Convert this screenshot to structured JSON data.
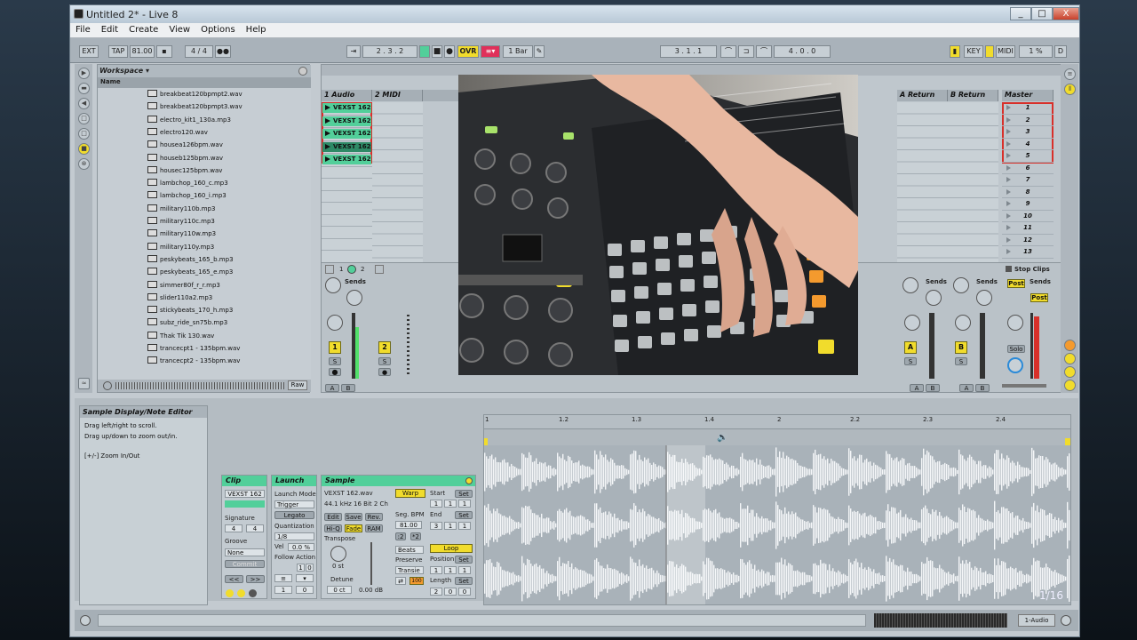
{
  "window": {
    "title": "Untitled 2* - Live 8",
    "min": "_",
    "max": "□",
    "close": "X"
  },
  "menu": [
    "File",
    "Edit",
    "Create",
    "View",
    "Options",
    "Help"
  ],
  "control_bar": {
    "ext": "EXT",
    "tap": "TAP",
    "tempo": "81.00",
    "signature": "4 / 4",
    "metro": "●●",
    "position": "2 .  3 .  2",
    "ovr": "OVR",
    "quantize": "1 Bar",
    "loop_start": "3 .  1 .  1",
    "loop_len": "4 .  0 .  0",
    "key": "KEY",
    "midi": "MIDI",
    "cpu": "1 %",
    "d": "D"
  },
  "browser": {
    "workspace": "Workspace ▾",
    "name_header": "Name",
    "files": [
      "breakbeat120bpmpt2.wav",
      "breakbeat120bpmpt3.wav",
      "electro_kit1_130a.mp3",
      "electro120.wav",
      "housea126bpm.wav",
      "houseb125bpm.wav",
      "housec125bpm.wav",
      "lambchop_160_c.mp3",
      "lambchop_160_i.mp3",
      "military110b.mp3",
      "military110c.mp3",
      "military110w.mp3",
      "military110y.mp3",
      "peskybeats_165_b.mp3",
      "peskybeats_165_e.mp3",
      "simmer80f_r_r.mp3",
      "slider110a2.mp3",
      "stickybeats_170_h.mp3",
      "subz_ride_sn75b.mp3",
      "Thak Tik 130.wav",
      "trancecpt1 - 135bpm.wav",
      "trancecpt2 - 135bpm.wav"
    ],
    "raw": "Raw"
  },
  "session": {
    "tracks": [
      "1 Audio",
      "2 MIDI"
    ],
    "returns": [
      "A Return",
      "B Return"
    ],
    "master": "Master",
    "clips": [
      "VEXST 162",
      "VEXST 162",
      "VEXST 162",
      "VEXST 162",
      "VEXST 162"
    ],
    "scenes": [
      "1",
      "2",
      "3",
      "4",
      "5",
      "6",
      "7",
      "8",
      "9",
      "10",
      "11",
      "12",
      "13"
    ],
    "stop_clips": "Stop Clips",
    "sends": "Sends",
    "post": "Post",
    "solo": "Solo",
    "track1_num": "1",
    "track2_num": "2",
    "return_a": "A",
    "return_b": "B",
    "s": "S",
    "a": "A",
    "b": "B",
    "io_1": "1",
    "io_2": "2"
  },
  "info_view": {
    "title": "Sample Display/Note Editor",
    "line1": "Drag left/right to scroll.",
    "line2": "Drag up/down to zoom out/in.",
    "line3": "[+/-] Zoom In/Out"
  },
  "clip_view": {
    "clip_head": "Clip",
    "clip_name": "VEXST 162",
    "signature_label": "Signature",
    "sig_num": "4",
    "sig_den": "4",
    "groove_label": "Groove",
    "groove_value": "None",
    "commit": "Commit",
    "launch_head": "Launch",
    "launch_mode_label": "Launch Mode",
    "launch_mode": "Trigger",
    "legato": "Legato",
    "quantization_label": "Quantization",
    "quantization": "1/8",
    "vel_label": "Vel",
    "vel": "0.0 %",
    "follow_action": "Follow Action",
    "fa1": "1",
    "fa2": "0",
    "fa3": "0",
    "fa4": "1",
    "fa5": "0",
    "sample_head": "Sample",
    "sample_name": "VEXST 162.wav",
    "sample_info": "44.1 kHz 16 Bit 2 Ch",
    "warp": "Warp",
    "edit": "Edit",
    "save": "Save",
    "rev": "Rev.",
    "hiq": "Hi-Q",
    "fade": "Fade",
    "ram": "RAM",
    "seg_bpm_label": "Seg. BPM",
    "seg_bpm": "81.00",
    "half": ":2",
    "double": "*2",
    "transpose_label": "Transpose",
    "transpose": "0 st",
    "beats": "Beats",
    "preserve_label": "Preserve",
    "preserve": "Transie",
    "detune_label": "Detune",
    "detune": "0 ct",
    "gain": "0.00 dB",
    "hundred": "100",
    "start_label": "Start",
    "start": [
      "1",
      "1",
      "1"
    ],
    "end_label": "End",
    "end": [
      "3",
      "1",
      "1"
    ],
    "loop": "Loop",
    "position_label": "Position",
    "position": [
      "1",
      "1",
      "1"
    ],
    "length_label": "Length",
    "length": [
      "2",
      "0",
      "0"
    ],
    "set": "Set"
  },
  "sample_editor": {
    "ruler": [
      "1",
      "1.2",
      "1.3",
      "1.4",
      "2",
      "2.2",
      "2.3",
      "2.4"
    ],
    "zoom": "1/16"
  },
  "status": {
    "track": "1-Audio"
  },
  "colors": {
    "clip_green": "#52cf9a",
    "yellow": "#f1dc2c",
    "orange": "#f49a2e",
    "red_outline": "#d8302a"
  }
}
